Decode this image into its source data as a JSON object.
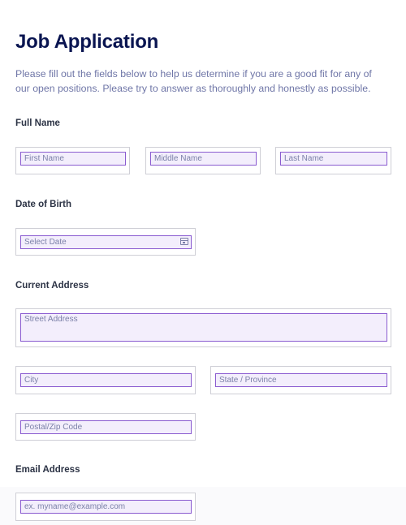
{
  "form": {
    "title": "Job Application",
    "intro": "Please fill out the fields below to help us determine if you are a good fit for any of our open positions. Please try to answer as thoroughly and honestly as possible."
  },
  "full_name": {
    "label": "Full Name",
    "first_placeholder": "First Name",
    "middle_placeholder": "Middle Name",
    "last_placeholder": "Last Name"
  },
  "dob": {
    "label": "Date of Birth",
    "placeholder": "Select Date",
    "icon": "calendar-icon"
  },
  "address": {
    "label": "Current Address",
    "street_placeholder": "Street Address",
    "city_placeholder": "City",
    "state_placeholder": "State / Province",
    "zip_placeholder": "Postal/Zip Code"
  },
  "email": {
    "label": "Email Address",
    "placeholder": "ex. myname@example.com"
  },
  "colors": {
    "title": "#0a1551",
    "field_border": "#8a5bd0",
    "field_bg": "#f3eefc"
  }
}
